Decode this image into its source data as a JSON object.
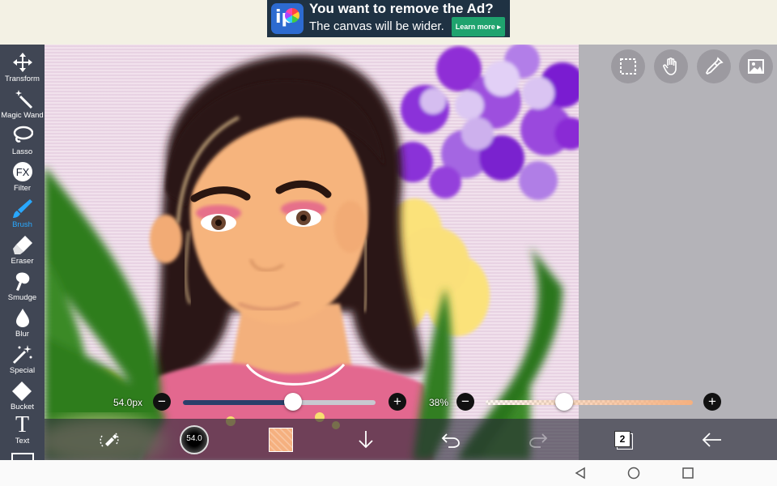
{
  "ad": {
    "title": "You want to remove the Ad?",
    "subtitle": "The canvas will be wider.",
    "button": "Learn more",
    "logo_text": "ip"
  },
  "tools": [
    {
      "name": "transform",
      "label": "Transform",
      "icon": "move-arrows-icon"
    },
    {
      "name": "magic-wand",
      "label": "Magic Wand",
      "icon": "magic-wand-icon"
    },
    {
      "name": "lasso",
      "label": "Lasso",
      "icon": "lasso-icon"
    },
    {
      "name": "filter",
      "label": "Filter",
      "icon": "fx-icon"
    },
    {
      "name": "brush",
      "label": "Brush",
      "icon": "brush-icon",
      "active": true
    },
    {
      "name": "eraser",
      "label": "Eraser",
      "icon": "eraser-icon"
    },
    {
      "name": "smudge",
      "label": "Smudge",
      "icon": "smudge-icon"
    },
    {
      "name": "blur",
      "label": "Blur",
      "icon": "droplet-icon"
    },
    {
      "name": "special",
      "label": "Special",
      "icon": "sparkle-wand-icon"
    },
    {
      "name": "bucket",
      "label": "Bucket",
      "icon": "bucket-icon"
    },
    {
      "name": "text",
      "label": "Text",
      "icon": "text-icon"
    }
  ],
  "text_tool_glyph": "T",
  "size_slider": {
    "value_label": "54.0px",
    "fraction": 0.57
  },
  "opacity_slider": {
    "value_label": "38%",
    "fraction": 0.38
  },
  "bottom": {
    "brush_size": "54.0",
    "layer_count": "2"
  },
  "colors": {
    "accent": "#29a8ff",
    "brush_color": "#f5b07f",
    "toolbar": "#141c2e"
  }
}
